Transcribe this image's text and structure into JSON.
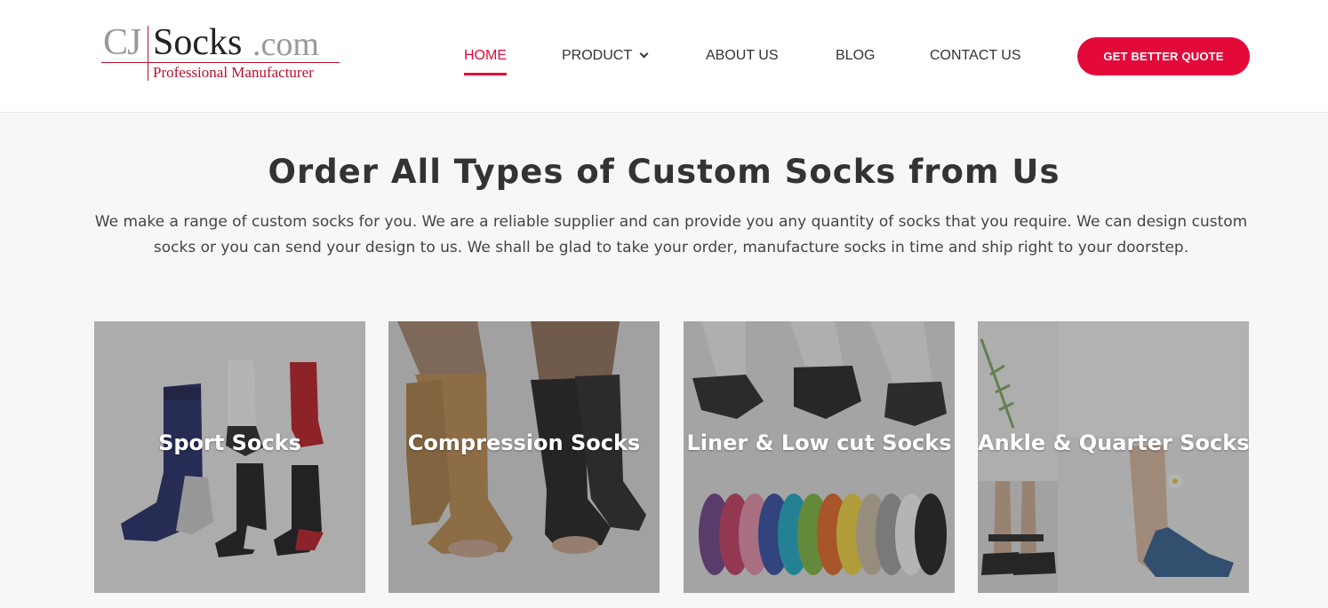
{
  "logo": {
    "brand_left": "CJ",
    "brand_main": "Socks",
    "brand_suffix": ".com",
    "tagline": "Professional Manufacturer"
  },
  "nav": {
    "home": "HOME",
    "product": "PRODUCT",
    "about": "ABOUT US",
    "blog": "BLOG",
    "contact": "CONTACT US",
    "active": "home"
  },
  "cta": {
    "label": "GET BETTER QUOTE"
  },
  "main": {
    "title": "Order All Types of Custom Socks from Us",
    "intro_line1": "We make a range of custom socks for you. We are a reliable supplier and can provide you any quantity of socks that you require. We can design custom",
    "intro_line2": "socks or you can send your design to us. We shall be glad to take your order, manufacture socks in time and ship right to your doorstep."
  },
  "categories": [
    {
      "label": "Sport Socks"
    },
    {
      "label": "Compression Socks"
    },
    {
      "label": "Liner & Low cut Socks"
    },
    {
      "label": "Ankle & Quarter Socks"
    }
  ],
  "colors": {
    "accent": "#e30a3a",
    "logo_red": "#b8102a",
    "page_bg": "#f7f7f7"
  }
}
